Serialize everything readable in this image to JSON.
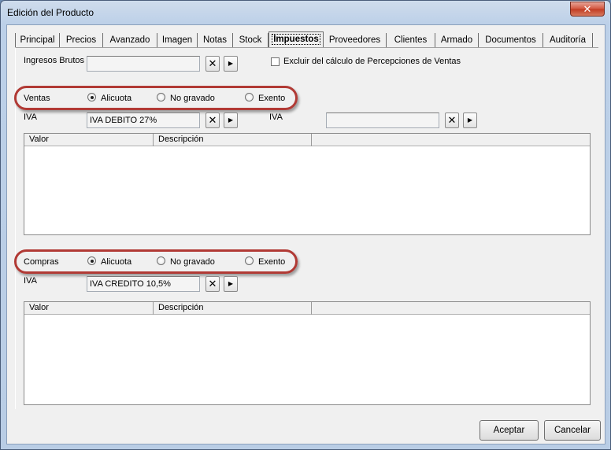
{
  "window": {
    "title": "Edición del Producto",
    "close_glyph": "✕"
  },
  "tabs": [
    {
      "label": "Principal"
    },
    {
      "label": "Precios"
    },
    {
      "label": "Avanzado"
    },
    {
      "label": "Imagen"
    },
    {
      "label": "Notas"
    },
    {
      "label": "Stock"
    },
    {
      "label": "Impuestos"
    },
    {
      "label": "Proveedores"
    },
    {
      "label": "Clientes"
    },
    {
      "label": "Armado"
    },
    {
      "label": "Documentos"
    },
    {
      "label": "Auditoría"
    }
  ],
  "active_tab": "Impuestos",
  "ingresos": {
    "label": "Ingresos Brutos",
    "value": "",
    "exclude_label": "Excluir del cálculo de Percepciones de Ventas"
  },
  "ventas": {
    "label": "Ventas",
    "options": [
      "Alicuota",
      "No gravado",
      "Exento"
    ],
    "selected": "Alicuota",
    "iva_label": "IVA",
    "iva_value": "IVA DEBITO 27%",
    "iva2_label": "IVA",
    "iva2_value": "",
    "grid_cols": [
      "Valor",
      "Descripción"
    ]
  },
  "compras": {
    "label": "Compras",
    "options": [
      "Alicuota",
      "No gravado",
      "Exento"
    ],
    "selected": "Alicuota",
    "iva_label": "IVA",
    "iva_value": "IVA CREDITO 10,5%",
    "grid_cols": [
      "Valor",
      "Descripción"
    ]
  },
  "buttons": {
    "clear_glyph": "✕",
    "arrow_glyph": "▶",
    "accept": "Aceptar",
    "cancel": "Cancelar"
  },
  "colors": {
    "highlight": "#b13a35",
    "titlebar": "#bcd0e8"
  }
}
